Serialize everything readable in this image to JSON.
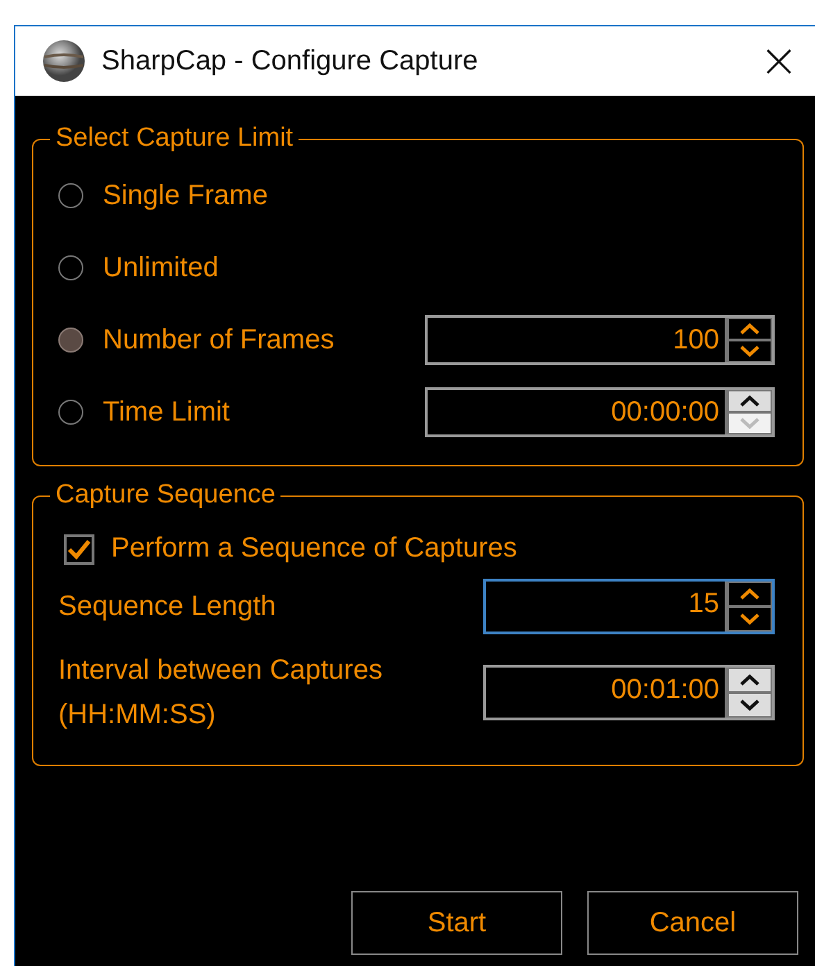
{
  "window": {
    "title": "SharpCap - Configure Capture",
    "close": "×"
  },
  "capture_limit": {
    "title": "Select Capture Limit",
    "options": [
      {
        "label": "Single Frame",
        "selected": false
      },
      {
        "label": "Unlimited",
        "selected": false
      },
      {
        "label": "Number of Frames",
        "selected": true,
        "spinner": {
          "value": "100",
          "kind": "accent",
          "disabled": false,
          "focused": false
        }
      },
      {
        "label": "Time Limit",
        "selected": false,
        "spinner": {
          "value": "00:00:00",
          "kind": "plain",
          "disabled": true,
          "focused": false
        }
      }
    ]
  },
  "capture_sequence": {
    "title": "Capture Sequence",
    "checkbox": {
      "label": "Perform a Sequence of Captures",
      "checked": true
    },
    "fields": [
      {
        "label": "Sequence Length",
        "spinner": {
          "value": "15",
          "kind": "accent",
          "disabled": false,
          "focused": true
        }
      },
      {
        "label": "Interval between Captures\n(HH:MM:SS)",
        "spinner": {
          "value": "00:01:00",
          "kind": "plain",
          "disabled": false,
          "focused": false
        }
      }
    ]
  },
  "buttons": [
    "Start",
    "Cancel"
  ]
}
